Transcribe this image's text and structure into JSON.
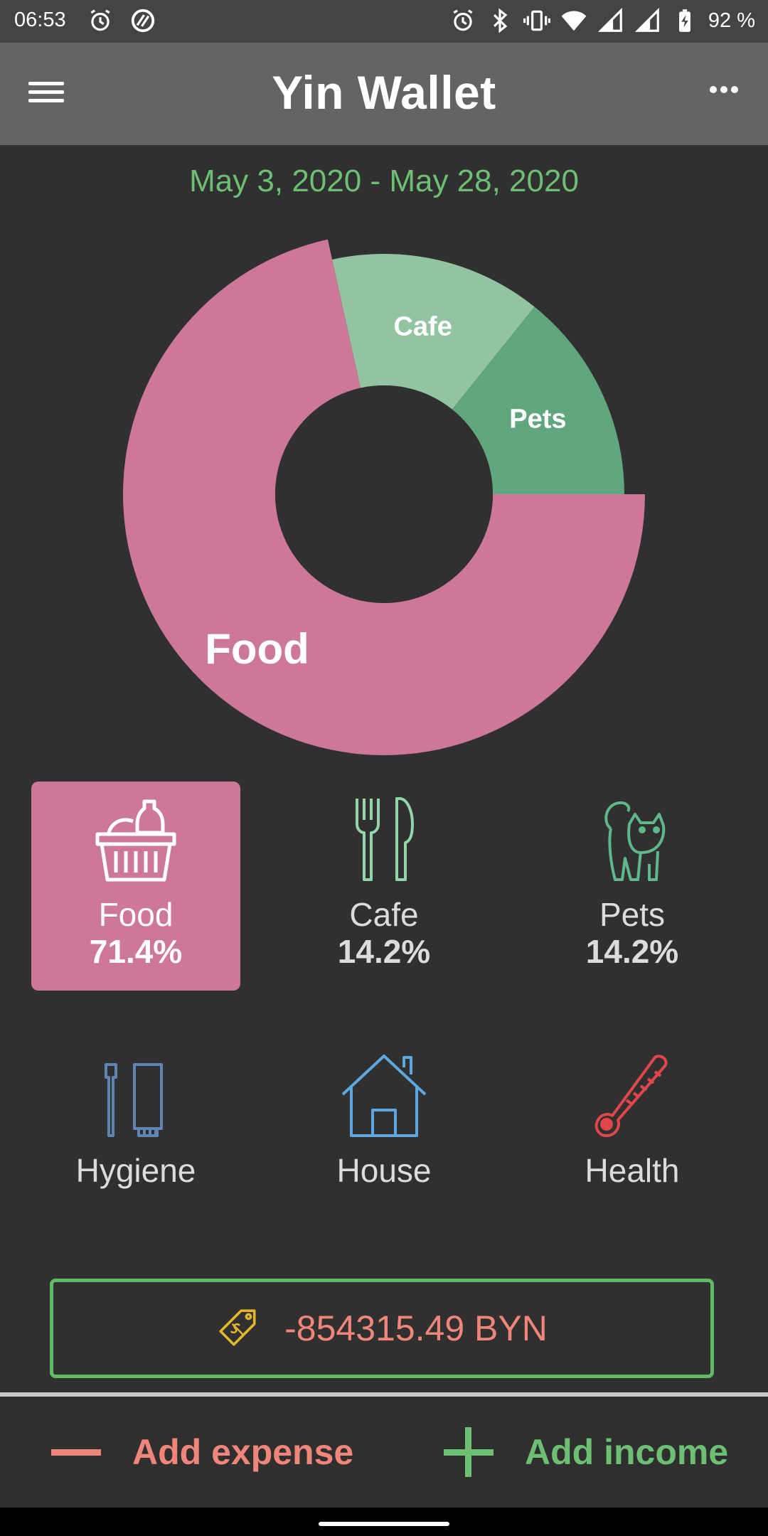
{
  "status_bar": {
    "time": "06:53",
    "battery": "92 %",
    "icons": [
      "alarm-icon",
      "do-not-disturb-icon",
      "alarm-icon",
      "bluetooth-icon",
      "vibrate-icon",
      "wifi-icon",
      "signal-icon",
      "signal-icon",
      "battery-charging-icon"
    ]
  },
  "app_bar": {
    "title": "Yin Wallet",
    "menu_icon": "hamburger-menu-icon",
    "more_icon": "more-dots-icon"
  },
  "date_range": "May 3, 2020 - May 28, 2020",
  "chart_data": {
    "type": "pie",
    "categories": [
      "Food",
      "Cafe",
      "Pets"
    ],
    "values": [
      71.4,
      14.2,
      14.2
    ],
    "colors": [
      "#cd7799",
      "#93c4a1",
      "#60a67e"
    ]
  },
  "categories": [
    {
      "name": "Food",
      "percent": "71.4%",
      "icon": "food-basket-icon",
      "color": "#ffffff",
      "selected": true
    },
    {
      "name": "Cafe",
      "percent": "14.2%",
      "icon": "fork-knife-icon",
      "color": "#93d4a8",
      "selected": false
    },
    {
      "name": "Pets",
      "percent": "14.2%",
      "icon": "cat-icon",
      "color": "#5fb88a",
      "selected": false
    },
    {
      "name": "Hygiene",
      "percent": "",
      "icon": "toothbrush-toothpaste-icon",
      "color": "#5f86b0",
      "selected": false
    },
    {
      "name": "House",
      "percent": "",
      "icon": "house-icon",
      "color": "#5ea8e0",
      "selected": false
    },
    {
      "name": "Health",
      "percent": "",
      "icon": "thermometer-icon",
      "color": "#e0464a",
      "selected": false
    }
  ],
  "balance": {
    "value": "-854315.49 BYN",
    "icon": "price-tag-icon",
    "color": "#f0867a"
  },
  "actions": {
    "expense": {
      "label": "Add expense",
      "color": "#f0867a"
    },
    "income": {
      "label": "Add income",
      "color": "#6cbf73"
    }
  }
}
